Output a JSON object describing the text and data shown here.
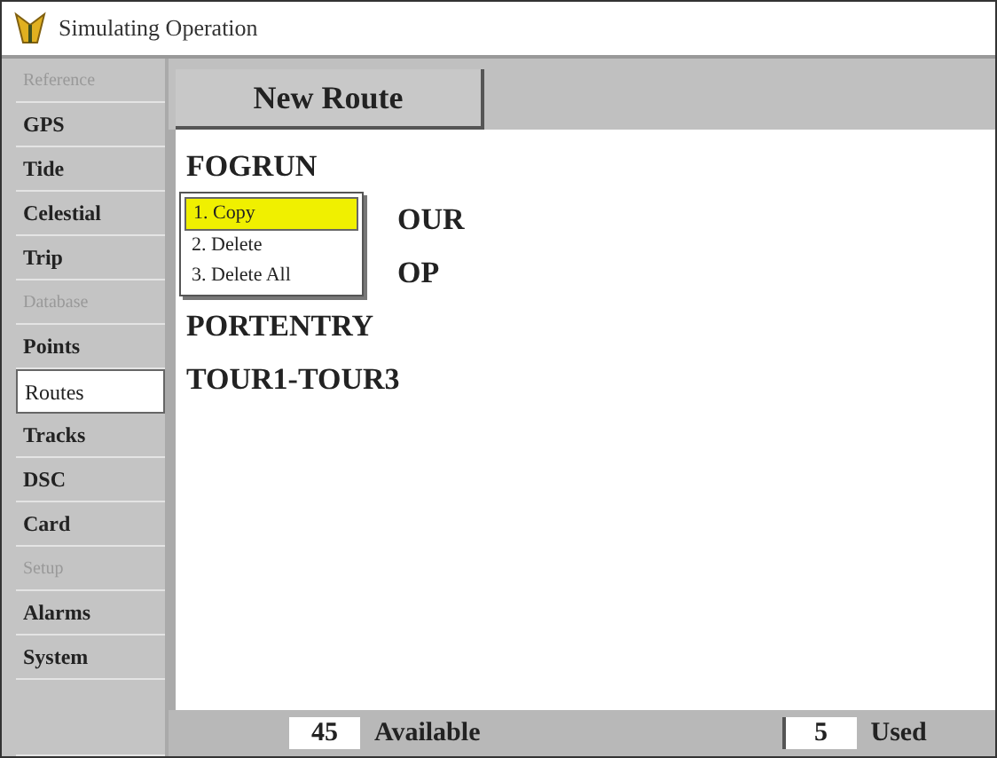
{
  "window": {
    "title": "Simulating Operation"
  },
  "sidebar": {
    "items": [
      {
        "label": "Reference",
        "kind": "header"
      },
      {
        "label": "GPS",
        "kind": "tab",
        "selected": false
      },
      {
        "label": "Tide",
        "kind": "tab",
        "selected": false
      },
      {
        "label": "Celestial",
        "kind": "tab",
        "selected": false
      },
      {
        "label": "Trip",
        "kind": "tab",
        "selected": false
      },
      {
        "label": "Database",
        "kind": "header"
      },
      {
        "label": "Points",
        "kind": "tab",
        "selected": false
      },
      {
        "label": "Routes",
        "kind": "tab",
        "selected": true
      },
      {
        "label": "Tracks",
        "kind": "tab",
        "selected": false
      },
      {
        "label": "DSC",
        "kind": "tab",
        "selected": false
      },
      {
        "label": "Card",
        "kind": "tab",
        "selected": false
      },
      {
        "label": "Setup",
        "kind": "header"
      },
      {
        "label": "Alarms",
        "kind": "tab",
        "selected": false
      },
      {
        "label": "System",
        "kind": "tab",
        "selected": false
      }
    ]
  },
  "toolbar": {
    "button": "New Route"
  },
  "routes": [
    {
      "name": "FOGRUN",
      "covered": false
    },
    {
      "name": "OUR",
      "covered": true
    },
    {
      "name": "OP",
      "covered": true
    },
    {
      "name": "PORTENTRY",
      "covered": false
    },
    {
      "name": "TOUR1-TOUR3",
      "covered": false
    }
  ],
  "context_menu": {
    "items": [
      {
        "label": "1. Copy",
        "selected": true
      },
      {
        "label": "2. Delete",
        "selected": false
      },
      {
        "label": "3. Delete All",
        "selected": false
      }
    ]
  },
  "status_bar": {
    "available_count": "45",
    "available_label": "Available",
    "used_count": "5",
    "used_label": "Used"
  }
}
